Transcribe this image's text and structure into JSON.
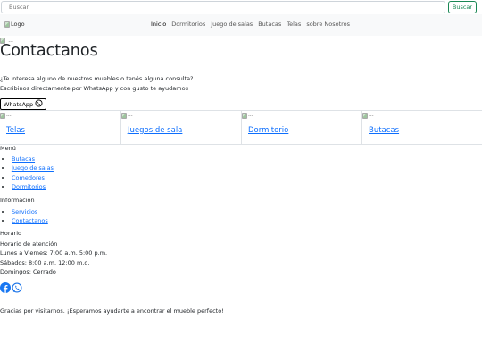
{
  "search": {
    "placeholder": "Buscar",
    "button_label": "Buscar"
  },
  "navbar": {
    "logo_alt": "Logo",
    "links": [
      {
        "label": "Inicio",
        "active": true
      },
      {
        "label": "Dormitorios",
        "active": false
      },
      {
        "label": "Juego de salas",
        "active": false
      },
      {
        "label": "Butacas",
        "active": false
      },
      {
        "label": "Telas",
        "active": false
      },
      {
        "label": "sobre Nosotros",
        "active": false
      }
    ]
  },
  "main": {
    "title": "Contactanos",
    "intro_line1": "¿Te interesa alguno de nuestros muebles o tenés alguna consulta?",
    "intro_line2": "Escribinos directamente por WhatsApp y con gusto te ayudamos",
    "whatsapp_label": "WhatsApp",
    "image_alt": "..."
  },
  "categories": [
    {
      "label": "Telas",
      "image_alt": "..."
    },
    {
      "label": "Juegos de sala",
      "image_alt": "..."
    },
    {
      "label": "Dormitorio",
      "image_alt": "..."
    },
    {
      "label": "Butacas",
      "image_alt": "..."
    }
  ],
  "footer": {
    "menu_heading": "Menú",
    "menu_items": [
      "Butacas",
      "Juego de salas",
      "Comedores",
      "Dormitorios"
    ],
    "info_heading": "Información",
    "info_items": [
      "Servicios",
      "Contactanos"
    ],
    "schedule_heading": "Horario",
    "schedule_lines": [
      "Horario de atención",
      "Lunes a Viernes: 7:00 a.m. 5:00 p.m.",
      "Sábados: 8:00 a.m. 12:00 m.d.",
      "Domingos: Cerrado"
    ],
    "social_icons": [
      "facebook-icon",
      "whatsapp-icon"
    ],
    "thanks": "Gracias por visitarnos. ¡Esperamos ayudarte a encontrar el mueble perfecto!"
  },
  "colors": {
    "link": "#0d6efd",
    "search_button": "#198754",
    "facebook": "#1877f2",
    "navbar_bg": "#f8f9fa"
  }
}
